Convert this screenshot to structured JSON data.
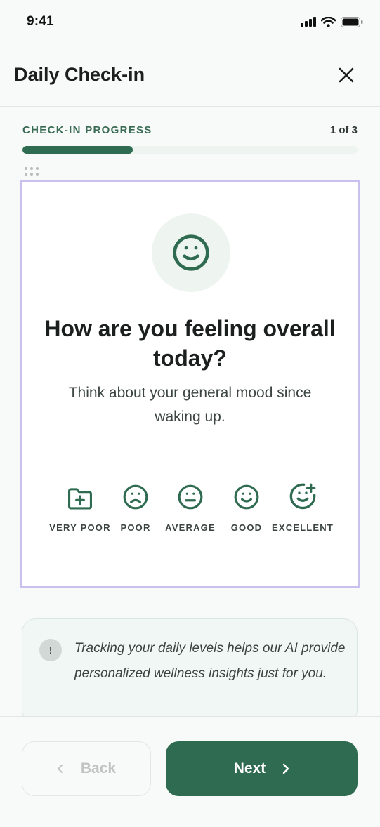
{
  "status": {
    "time": "9:41"
  },
  "header": {
    "title": "Daily Check-in"
  },
  "progress": {
    "label": "CHECK-IN PROGRESS",
    "count": "1 of 3",
    "fraction": 0.33
  },
  "question": {
    "title": "How are you feeling overall today?",
    "subtitle": "Think about your general mood since waking up."
  },
  "options": [
    {
      "label": "VERY POOR",
      "icon": "folder-plus-icon"
    },
    {
      "label": "POOR",
      "icon": "frown-icon"
    },
    {
      "label": "AVERAGE",
      "icon": "neutral-face-icon"
    },
    {
      "label": "GOOD",
      "icon": "smile-icon"
    },
    {
      "label": "EXCELLENT",
      "icon": "smile-plus-icon"
    }
  ],
  "info": {
    "text": "Tracking your daily levels helps our AI provide personalized wellness insights just for you.",
    "icon": "!"
  },
  "footer": {
    "back_label": "Back",
    "next_label": "Next"
  },
  "colors": {
    "accent": "#2f6b50",
    "accent_soft": "#eef5f1",
    "card_border": "#c9c0f0"
  }
}
